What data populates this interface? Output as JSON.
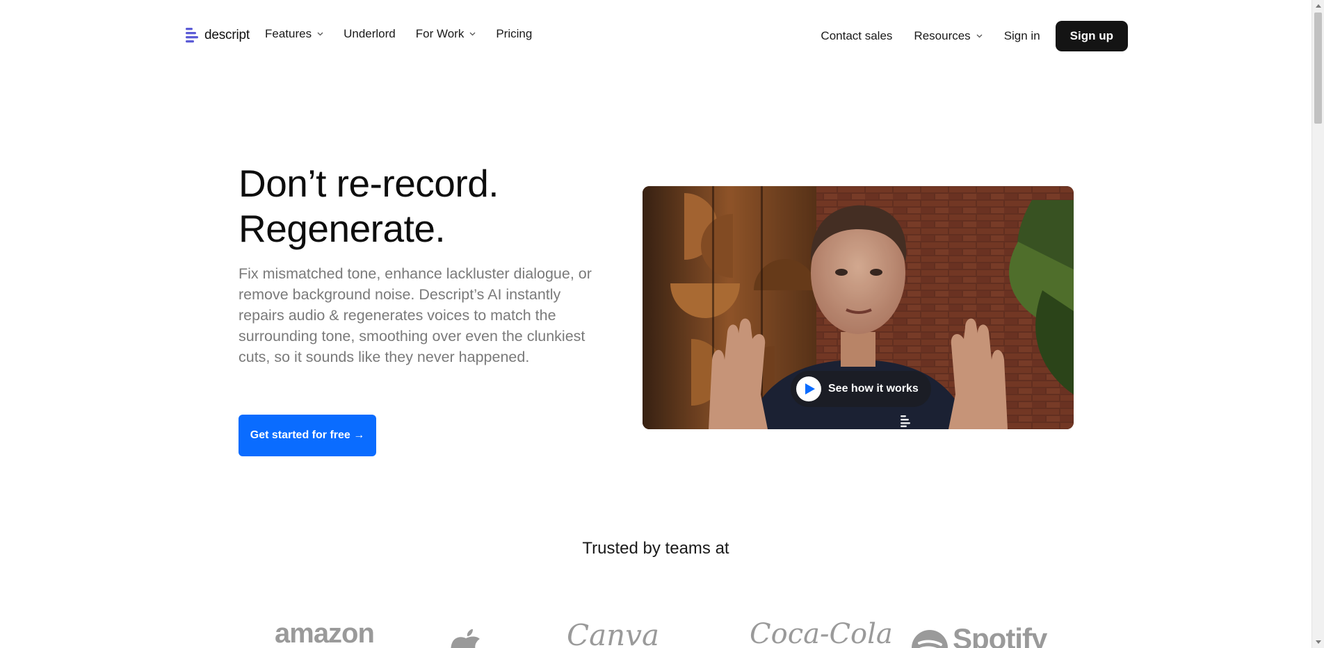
{
  "nav": {
    "logo_text": "descript",
    "left_items": [
      {
        "label": "Features",
        "has_dropdown": true
      },
      {
        "label": "Underlord",
        "has_dropdown": false
      },
      {
        "label": "For Work",
        "has_dropdown": true
      },
      {
        "label": "Pricing",
        "has_dropdown": false
      }
    ],
    "right_items": [
      {
        "label": "Contact sales",
        "has_dropdown": false
      },
      {
        "label": "Resources",
        "has_dropdown": true
      },
      {
        "label": "Sign in",
        "has_dropdown": false
      }
    ],
    "signup_label": "Sign up"
  },
  "hero": {
    "title_line1": "Don’t re-record.",
    "title_line2": "Regenerate.",
    "subtitle": "Fix mismatched tone, enhance lackluster dialogue, or remove background noise. Descript’s AI instantly repairs audio & regenerates voices to match the surrounding tone, smoothing over even the clunkiest cuts, so it sounds like they never happened.",
    "cta_label": "Get started for free →"
  },
  "video": {
    "play_label": "See how it works",
    "icons": [
      "play-icon",
      "descript-watermark-icon"
    ]
  },
  "trusted": {
    "heading": "Trusted by teams at",
    "brands": [
      "amazon",
      "apple",
      "Canva",
      "Coca-Cola",
      "Spotify"
    ],
    "brand_text": {
      "amazon": "amazon",
      "canva": "Canva",
      "cocacola": "Coca-Cola",
      "spotify": "Spotify"
    }
  },
  "colors": {
    "accent": "#0a6cff",
    "logo_accent": "#5b5bd6",
    "signup_bg": "#141414",
    "subtitle_text": "#7a7a7a",
    "brand_gray": "#9a9a9a"
  }
}
